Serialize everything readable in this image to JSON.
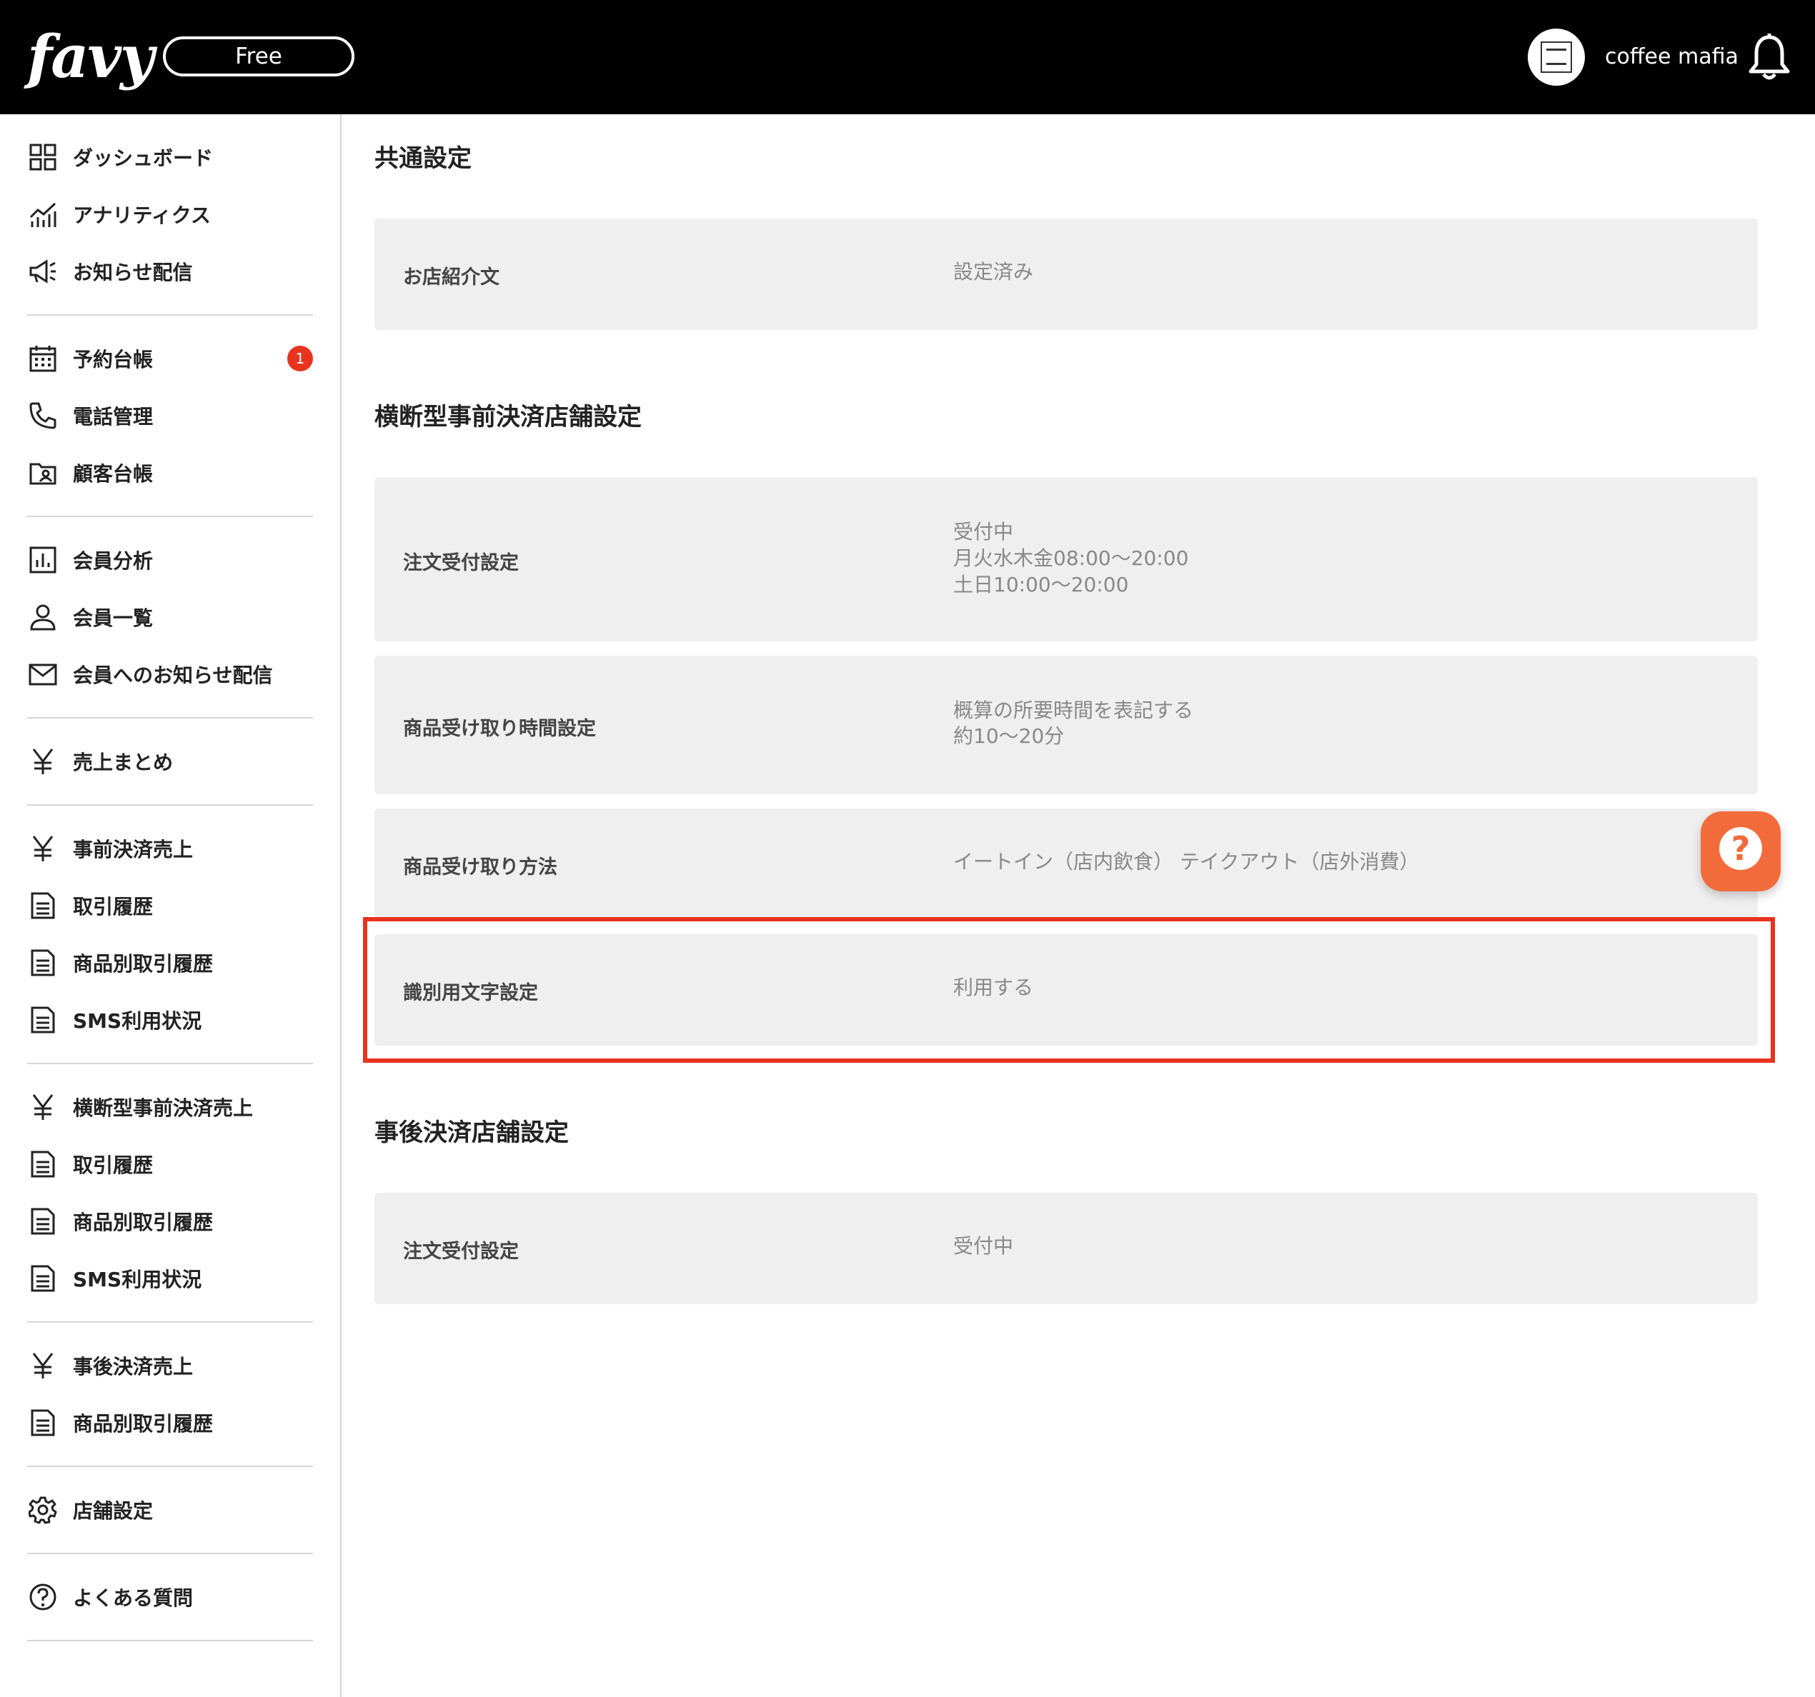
{
  "header": {
    "logo": "favy",
    "plan": "Free",
    "user_name": "coffee mafia"
  },
  "sidebar": {
    "items": [
      {
        "label": "ダッシュボード",
        "icon": "dashboard-grid-icon"
      },
      {
        "label": "アナリティクス",
        "icon": "analytics-chart-icon"
      },
      {
        "label": "お知らせ配信",
        "icon": "megaphone-icon"
      },
      {
        "label": "予約台帳",
        "icon": "calendar-icon",
        "badge": "1"
      },
      {
        "label": "電話管理",
        "icon": "phone-icon"
      },
      {
        "label": "顧客台帳",
        "icon": "customer-folder-icon"
      },
      {
        "label": "会員分析",
        "icon": "bar-chart-icon"
      },
      {
        "label": "会員一覧",
        "icon": "person-icon"
      },
      {
        "label": "会員へのお知らせ配信",
        "icon": "mail-icon"
      },
      {
        "label": "売上まとめ",
        "icon": "yen-icon"
      },
      {
        "label": "事前決済売上",
        "icon": "yen-icon"
      },
      {
        "label": "取引履歴",
        "icon": "document-icon"
      },
      {
        "label": "商品別取引履歴",
        "icon": "document-icon"
      },
      {
        "label": "SMS利用状況",
        "icon": "document-icon"
      },
      {
        "label": "横断型事前決済売上",
        "icon": "yen-icon"
      },
      {
        "label": "取引履歴",
        "icon": "document-icon"
      },
      {
        "label": "商品別取引履歴",
        "icon": "document-icon"
      },
      {
        "label": "SMS利用状況",
        "icon": "document-icon"
      },
      {
        "label": "事後決済売上",
        "icon": "yen-icon"
      },
      {
        "label": "商品別取引履歴",
        "icon": "document-icon"
      },
      {
        "label": "店舗設定",
        "icon": "gear-icon"
      },
      {
        "label": "よくある質問",
        "icon": "question-circle-icon"
      }
    ]
  },
  "main": {
    "sections": [
      {
        "title": "共通設定",
        "rows": [
          {
            "label": "お店紹介文",
            "value": [
              "設定済み"
            ]
          }
        ]
      },
      {
        "title": "横断型事前決済店舗設定",
        "rows": [
          {
            "label": "注文受付設定",
            "value": [
              "受付中",
              "月火水木金08:00〜20:00",
              "土日10:00〜20:00"
            ]
          },
          {
            "label": "商品受け取り時間設定",
            "value": [
              "概算の所要時間を表記する",
              "約10〜20分"
            ]
          },
          {
            "label": "商品受け取り方法",
            "value": [
              "イートイン（店内飲食） テイクアウト（店外消費）"
            ]
          },
          {
            "label": "識別用文字設定",
            "value": [
              "利用する"
            ]
          }
        ]
      },
      {
        "title": "事後決済店舗設定",
        "rows": [
          {
            "label": "注文受付設定",
            "value": [
              "受付中"
            ]
          }
        ]
      }
    ]
  },
  "colors": {
    "header_bg": "#000000",
    "card_bg": "#efefef",
    "highlight": "#e8331f",
    "badge": "#e8331f",
    "help_button": "#f26b3a"
  }
}
